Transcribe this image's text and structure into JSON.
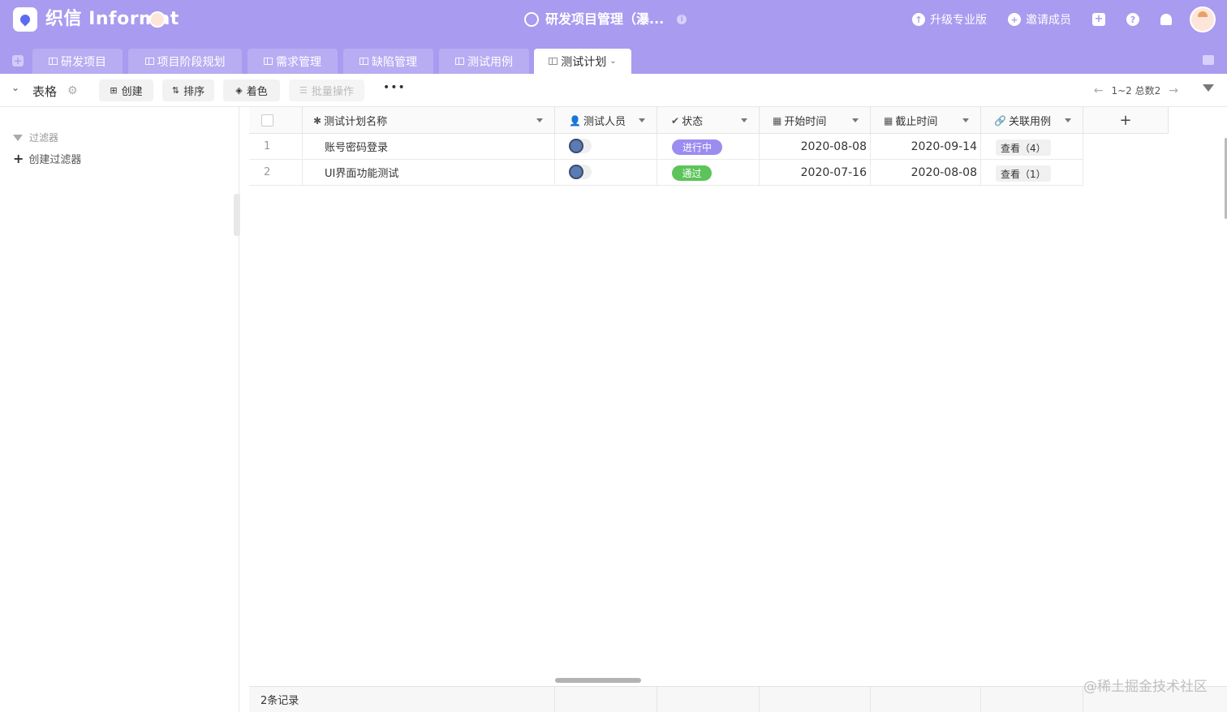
{
  "app": {
    "brand": "织信 Informat",
    "title": "研发项目管理（瀑...",
    "actions": {
      "upgrade": "升级专业版",
      "invite": "邀请成员"
    }
  },
  "tabs": [
    {
      "label": "研发项目"
    },
    {
      "label": "项目阶段规划"
    },
    {
      "label": "需求管理"
    },
    {
      "label": "缺陷管理"
    },
    {
      "label": "测试用例"
    },
    {
      "label": "测试计划",
      "active": true
    }
  ],
  "toolbar": {
    "view_label": "表格",
    "create": "创建",
    "sort": "排序",
    "color": "着色",
    "batch": "批量操作",
    "pager": "1~2 总数2"
  },
  "sidebar": {
    "filter_title": "过滤器",
    "create_filter": "创建过滤器"
  },
  "table": {
    "columns": [
      {
        "label": "测试计划名称"
      },
      {
        "label": "测试人员"
      },
      {
        "label": "状态"
      },
      {
        "label": "开始时间"
      },
      {
        "label": "截止时间"
      },
      {
        "label": "关联用例"
      }
    ],
    "rows": [
      {
        "num": "1",
        "name": "账号密码登录",
        "status": "进行中",
        "status_color": "#9b8cf0",
        "start": "2020-08-08",
        "end": "2020-09-14",
        "cases": "查看（4）"
      },
      {
        "num": "2",
        "name": "UI界面功能测试",
        "status": "通过",
        "status_color": "#5cc45a",
        "start": "2020-07-16",
        "end": "2020-08-08",
        "cases": "查看（1）"
      }
    ]
  },
  "footer": {
    "count": "2条记录"
  },
  "watermark": "@稀土掘金技术社区",
  "colors": {
    "header": "#a99bf0",
    "tab_inactive": "#b8adf3"
  }
}
